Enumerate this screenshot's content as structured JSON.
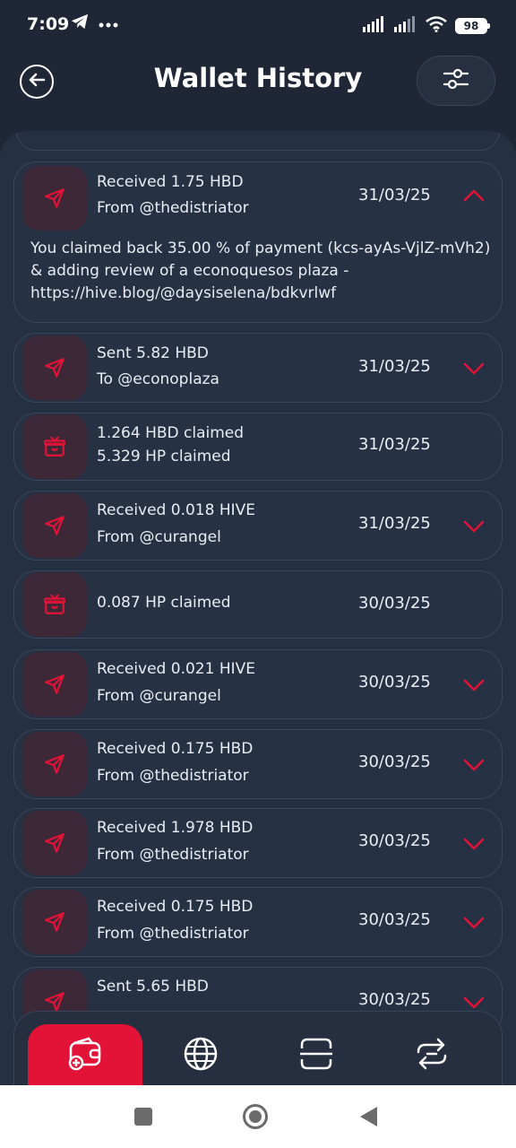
{
  "status_bar": {
    "time": "7:09",
    "battery": "98",
    "icons": [
      "telegram-icon",
      "more-dots-icon",
      "signal-icon",
      "signal-icon-2",
      "wifi-icon",
      "battery-icon"
    ]
  },
  "header": {
    "title": "Wallet History",
    "back_icon": "back-arrow-icon",
    "filter_icon": "sliders-icon"
  },
  "colors": {
    "accent": "#e31337",
    "background": "#1f2736",
    "card": "#263144",
    "icon_box": "#3d2837"
  },
  "transactions": [
    {
      "icon": "send-icon",
      "line1": "Received 1.75 HBD",
      "line2": "From @thedistriator",
      "date": "31/03/25",
      "chevron": "chevron-up-icon",
      "expanded": true,
      "description": "You claimed back 35.00 % of payment (kcs-ayAs-VjlZ-mVh2) & adding review of a econoquesos plaza - https://hive.blog/@daysiselena/bdkvrlwf"
    },
    {
      "icon": "send-icon",
      "line1": "Sent 5.82 HBD",
      "line2": "To @econoplaza",
      "date": "31/03/25",
      "chevron": "chevron-down-icon"
    },
    {
      "icon": "gift-icon",
      "line1": "1.264 HBD claimed",
      "line2": "5.329 HP claimed",
      "date": "31/03/25",
      "chevron": ""
    },
    {
      "icon": "send-icon",
      "line1": "Received 0.018 HIVE",
      "line2": "From @curangel",
      "date": "31/03/25",
      "chevron": "chevron-down-icon"
    },
    {
      "icon": "gift-icon",
      "line1": "0.087 HP claimed",
      "line2": "",
      "date": "30/03/25",
      "chevron": ""
    },
    {
      "icon": "send-icon",
      "line1": "Received 0.021 HIVE",
      "line2": "From @curangel",
      "date": "30/03/25",
      "chevron": "chevron-down-icon"
    },
    {
      "icon": "send-icon",
      "line1": "Received 0.175 HBD",
      "line2": "From @thedistriator",
      "date": "30/03/25",
      "chevron": "chevron-down-icon"
    },
    {
      "icon": "send-icon",
      "line1": "Received 1.978 HBD",
      "line2": "From @thedistriator",
      "date": "30/03/25",
      "chevron": "chevron-down-icon"
    },
    {
      "icon": "send-icon",
      "line1": "Received 0.175 HBD",
      "line2": "From @thedistriator",
      "date": "30/03/25",
      "chevron": "chevron-down-icon"
    },
    {
      "icon": "send-icon",
      "line1": "Sent 5.65 HBD",
      "line2": "",
      "date": "30/03/25",
      "chevron": "chevron-down-icon"
    }
  ],
  "bottom_nav": {
    "items": [
      {
        "icon": "wallet-add-icon",
        "active": true
      },
      {
        "icon": "globe-icon",
        "active": false
      },
      {
        "icon": "scan-icon",
        "active": false
      },
      {
        "icon": "swap-icon",
        "active": false
      }
    ]
  },
  "system_nav": {
    "buttons": [
      "recents-square-icon",
      "home-circle-icon",
      "back-triangle-icon"
    ]
  }
}
